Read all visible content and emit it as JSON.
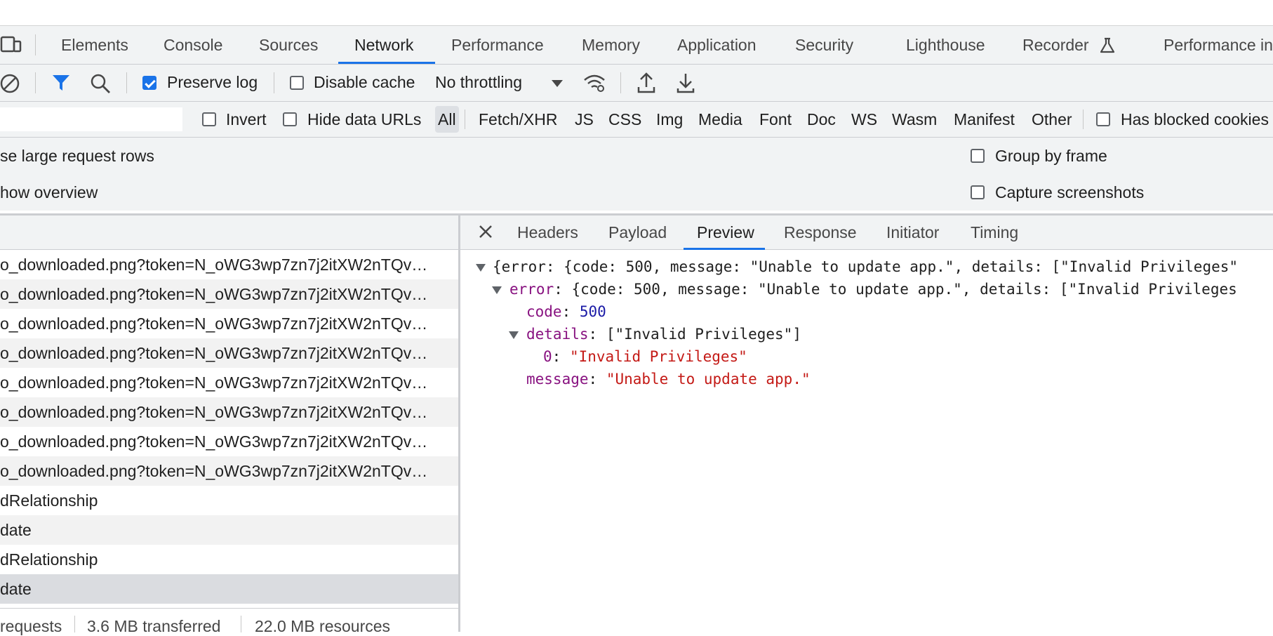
{
  "main_tabs": [
    {
      "label": "Elements"
    },
    {
      "label": "Console"
    },
    {
      "label": "Sources"
    },
    {
      "label": "Network"
    },
    {
      "label": "Performance"
    },
    {
      "label": "Memory"
    },
    {
      "label": "Application"
    },
    {
      "label": "Security"
    },
    {
      "label": "Lighthouse"
    },
    {
      "label": "Recorder"
    },
    {
      "label": "Performance in"
    }
  ],
  "active_main_tab": "Network",
  "toolbar": {
    "preserve_log": {
      "label": "Preserve log",
      "checked": true
    },
    "disable_cache": {
      "label": "Disable cache",
      "checked": false
    },
    "throttling": "No throttling"
  },
  "filterbar": {
    "invert": "Invert",
    "hide_data_urls": "Hide data URLs",
    "types": [
      "All",
      "Fetch/XHR",
      "JS",
      "CSS",
      "Img",
      "Media",
      "Font",
      "Doc",
      "WS",
      "Wasm",
      "Manifest",
      "Other"
    ],
    "active_type": "All",
    "has_blocked_cookies": "Has blocked cookies"
  },
  "options": {
    "large_rows": "se large request rows",
    "show_overview": "how overview",
    "group_by_frame": "Group by frame",
    "capture_screenshots": "Capture screenshots"
  },
  "requests": [
    "o_downloaded.png?token=N_oWG3wp7zn7j2itXW2nTQv…",
    "o_downloaded.png?token=N_oWG3wp7zn7j2itXW2nTQv…",
    "o_downloaded.png?token=N_oWG3wp7zn7j2itXW2nTQv…",
    "o_downloaded.png?token=N_oWG3wp7zn7j2itXW2nTQv…",
    "o_downloaded.png?token=N_oWG3wp7zn7j2itXW2nTQv…",
    "o_downloaded.png?token=N_oWG3wp7zn7j2itXW2nTQv…",
    "o_downloaded.png?token=N_oWG3wp7zn7j2itXW2nTQv…",
    "o_downloaded.png?token=N_oWG3wp7zn7j2itXW2nTQv…",
    "dRelationship",
    "date",
    "dRelationship",
    "date"
  ],
  "status": {
    "requests": "requests",
    "transferred": "3.6 MB transferred",
    "resources": "22.0 MB resources"
  },
  "detail_tabs": [
    "Headers",
    "Payload",
    "Preview",
    "Response",
    "Initiator",
    "Timing"
  ],
  "active_detail_tab": "Preview",
  "preview": {
    "line1": "{error: {code: 500, message: \"Unable to update app.\", details: [\"Invalid Privileges\"",
    "line2_key": "error",
    "line2_rest": "{code: 500, message: \"Unable to update app.\", details: [\"Invalid Privileges",
    "code_key": "code",
    "code_val": "500",
    "details_key": "details",
    "details_val": "[\"Invalid Privileges\"]",
    "item_key": "0",
    "item_val": "\"Invalid Privileges\"",
    "message_key": "message",
    "message_val": "\"Unable to update app.\""
  },
  "colors": {
    "accent": "#1a73e8",
    "key": "#881280",
    "string": "#c41a16",
    "number": "#1a1aa6"
  }
}
